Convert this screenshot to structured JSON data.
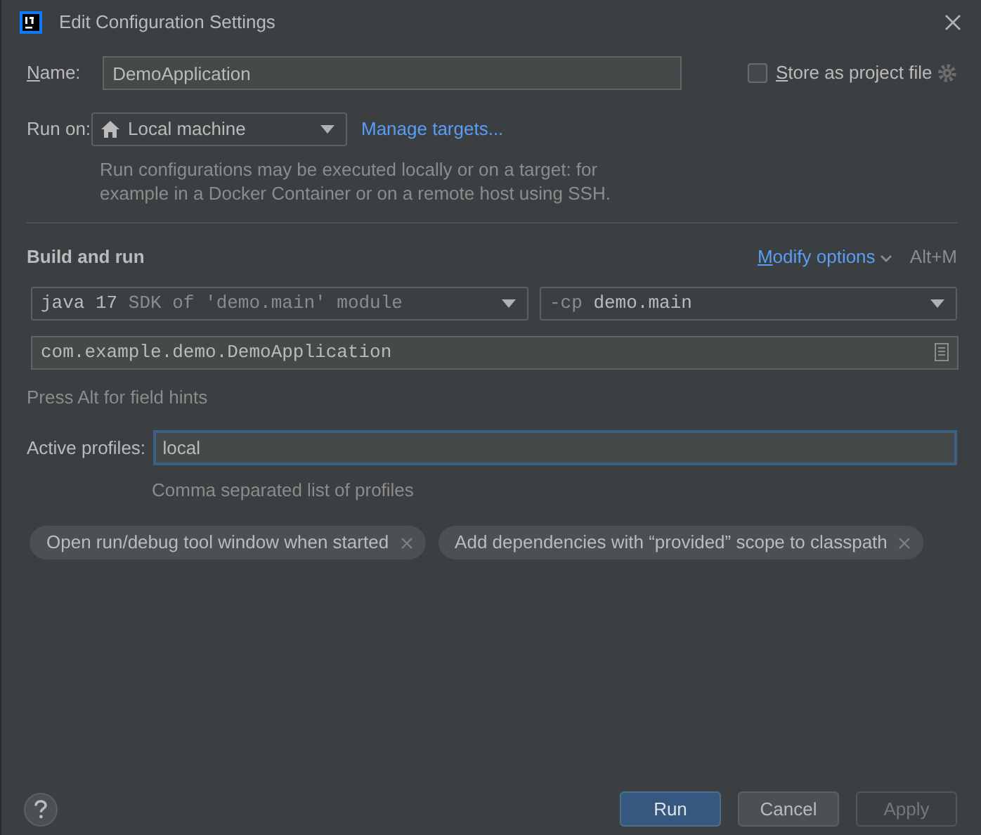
{
  "window": {
    "title": "Edit Configuration Settings"
  },
  "name": {
    "label": "Name:",
    "mnemonic_underlined": true,
    "value": "DemoApplication"
  },
  "store_as_project_file": {
    "label": "Store as project file",
    "mnemonic_underlined": true,
    "checked": false
  },
  "run_on": {
    "label": "Run on:",
    "value": "Local machine",
    "link": "Manage targets...",
    "hint_lines": [
      "Run configurations may be executed locally or on a target: for",
      "example in a Docker Container or on a remote host using SSH."
    ]
  },
  "build_and_run": {
    "title": "Build and run",
    "modify_options": {
      "label": "Modify options",
      "mnemonic_underlined": true,
      "shortcut": "Alt+M"
    },
    "jre": {
      "value": "java 17",
      "hint": "SDK of 'demo.main' module"
    },
    "classpath": {
      "prefix": "-cp",
      "value": "demo.main"
    },
    "main_class": "com.example.demo.DemoApplication",
    "field_hints": "Press Alt for field hints"
  },
  "active_profiles": {
    "label": "Active profiles:",
    "value": "local",
    "focused": true,
    "hint": "Comma separated list of profiles"
  },
  "option_tags": [
    {
      "label": "Open run/debug tool window when started"
    },
    {
      "label": "Add dependencies with “provided” scope to classpath"
    }
  ],
  "buttons": [
    {
      "label": "Run",
      "kind": "primary",
      "disabled": false
    },
    {
      "label": "Cancel",
      "kind": "normal",
      "disabled": false
    },
    {
      "label": "Apply",
      "kind": "normal",
      "disabled": true
    }
  ]
}
